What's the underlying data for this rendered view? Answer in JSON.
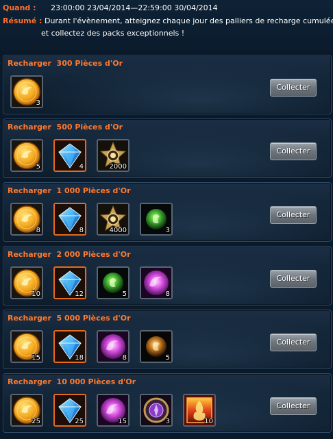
{
  "header": {
    "when_label": "Quand :",
    "when_value": "23:00:00 23/04/2014—22:59:00 30/04/2014",
    "summary_label": "Résumé :",
    "summary_line1": "Durant l'évènement, atteignez chaque jour des palliers de recharge cumulée",
    "summary_line2": "et collectez des packs exceptionnels !"
  },
  "panels": [
    {
      "title": "Recharger  300 Pièces d'Or",
      "button": "Collecter",
      "items": [
        {
          "icon": "gold-coin-icon",
          "count": "3"
        }
      ]
    },
    {
      "title": "Recharger  500 Pièces d'Or",
      "button": "Collecter",
      "items": [
        {
          "icon": "gold-coin-icon",
          "count": "5"
        },
        {
          "icon": "blue-gem-icon",
          "count": "4"
        },
        {
          "icon": "star-medal-icon",
          "count": "2000"
        }
      ]
    },
    {
      "title": "Recharger  1 000 Pièces d'Or",
      "button": "Collecter",
      "items": [
        {
          "icon": "gold-coin-icon",
          "count": "8"
        },
        {
          "icon": "blue-gem-icon",
          "count": "8"
        },
        {
          "icon": "star-medal-icon",
          "count": "4000"
        },
        {
          "icon": "green-orb-icon",
          "count": "3"
        }
      ]
    },
    {
      "title": "Recharger  2 000 Pièces d'Or",
      "button": "Collecter",
      "items": [
        {
          "icon": "gold-coin-icon",
          "count": "10"
        },
        {
          "icon": "blue-gem-icon",
          "count": "12"
        },
        {
          "icon": "green-orb-icon",
          "count": "5"
        },
        {
          "icon": "pink-orb-icon",
          "count": "8"
        }
      ]
    },
    {
      "title": "Recharger  5 000 Pièces d'Or",
      "button": "Collecter",
      "items": [
        {
          "icon": "gold-coin-icon",
          "count": "15"
        },
        {
          "icon": "blue-gem-icon",
          "count": "18"
        },
        {
          "icon": "pink-orb-icon",
          "count": "8"
        },
        {
          "icon": "amber-orb-icon",
          "count": "5"
        }
      ]
    },
    {
      "title": "Recharger  10 000 Pièces d'Or",
      "button": "Collecter",
      "items": [
        {
          "icon": "gold-coin-icon",
          "count": "25"
        },
        {
          "icon": "blue-gem-icon",
          "count": "25"
        },
        {
          "icon": "pink-orb-icon",
          "count": "15"
        },
        {
          "icon": "purple-amulet-icon",
          "count": "3"
        },
        {
          "icon": "fire-box-icon",
          "count": "10"
        }
      ]
    }
  ]
}
